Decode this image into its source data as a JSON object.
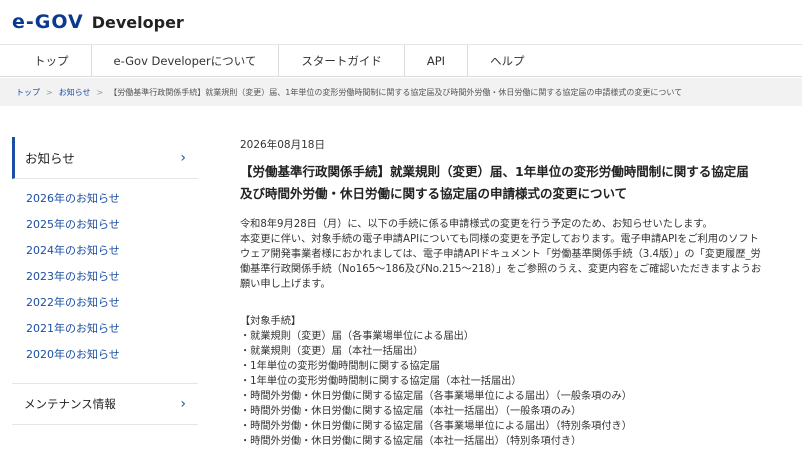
{
  "header": {
    "logo_text": "e-GOV",
    "logo_sub": "Developer"
  },
  "nav": {
    "items": [
      {
        "label": "トップ"
      },
      {
        "label": "e-Gov Developerについて"
      },
      {
        "label": "スタートガイド"
      },
      {
        "label": "API"
      },
      {
        "label": "ヘルプ"
      }
    ]
  },
  "breadcrumb": {
    "items": [
      {
        "label": "トップ"
      },
      {
        "label": "お知らせ"
      },
      {
        "label": "【労働基準行政関係手続】就業規則（変更）届、1年単位の変形労働時間制に関する協定届及び時間外労働・休日労働に関する協定届の申請様式の変更について"
      }
    ],
    "separator": ">"
  },
  "sidebar": {
    "heading": "お知らせ",
    "items": [
      {
        "label": "2026年のお知らせ"
      },
      {
        "label": "2025年のお知らせ"
      },
      {
        "label": "2024年のお知らせ"
      },
      {
        "label": "2023年のお知らせ"
      },
      {
        "label": "2022年のお知らせ"
      },
      {
        "label": "2021年のお知らせ"
      },
      {
        "label": "2020年のお知らせ"
      }
    ],
    "maintenance": "メンテナンス情報",
    "chevron": "›"
  },
  "article": {
    "date": "2026年08月18日",
    "title_line1": "【労働基準行政関係手続】就業規則（変更）届、1年単位の変形労働時間制に関する協定届",
    "title_line2": "及び時間外労働・休日労働に関する協定届の申請様式の変更について",
    "body_lines": [
      "令和8年9月28日（月）に、以下の手続に係る申請様式の変更を行う予定のため、お知らせいたします。",
      "本変更に伴い、対象手続の電子申請APIについても同様の変更を予定しております。電子申請APIをご利用のソフト",
      "ウェア開発事業者様におかれましては、電子申請APIドキュメント「労働基準関係手続（3.4版）」の「変更履歴_労",
      "働基準行政関係手続（No165～186及びNo.215～218）」をご参照のうえ、変更内容をご確認いただきますようお",
      "願い申し上げます。"
    ],
    "targets_heading": "【対象手続】",
    "targets": [
      "・就業規則（変更）届（各事業場単位による届出）",
      "・就業規則（変更）届（本社一括届出）",
      "・1年単位の変形労働時間制に関する協定届",
      "・1年単位の変形労働時間制に関する協定届（本社一括届出）",
      "・時間外労働・休日労働に関する協定届（各事業場単位による届出）（一般条項のみ）",
      "・時間外労働・休日労働に関する協定届（本社一括届出）（一般条項のみ）",
      "・時間外労働・休日労働に関する協定届（各事業場単位による届出）（特別条項付き）",
      "・時間外労働・休日労働に関する協定届（本社一括届出）（特別条項付き）"
    ]
  },
  "colors": {
    "brand_blue": "#1a4fa3",
    "logo_navy": "#0a3a8f",
    "breadcrumb_bg": "#f2f2f2"
  }
}
